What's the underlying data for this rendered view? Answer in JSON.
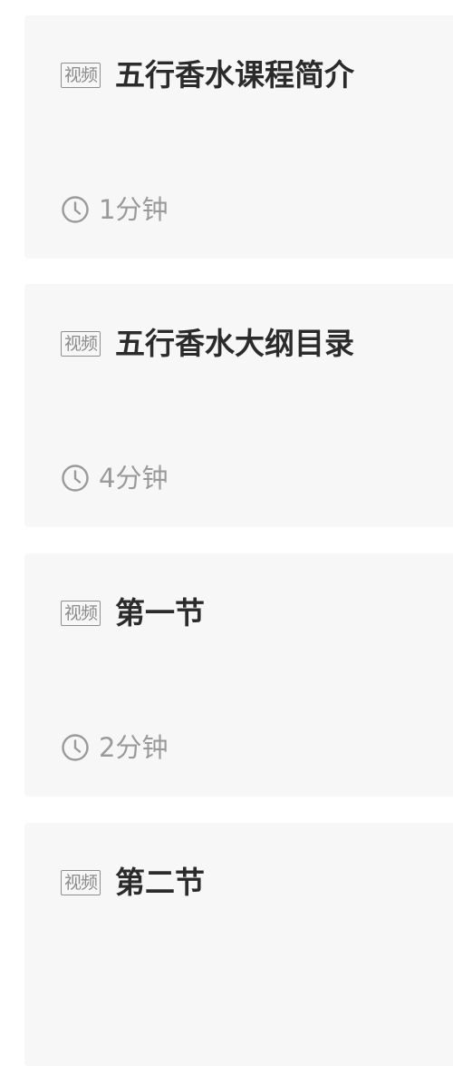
{
  "lessons": [
    {
      "badge": "视频",
      "title": "五行香水课程简介",
      "duration": "1分钟"
    },
    {
      "badge": "视频",
      "title": "五行香水大纲目录",
      "duration": "4分钟"
    },
    {
      "badge": "视频",
      "title": "第一节",
      "duration": "2分钟"
    },
    {
      "badge": "视频",
      "title": "第二节",
      "duration": ""
    }
  ],
  "icons": {
    "duration": "clock-icon"
  },
  "colors": {
    "card_background": "#f7f7f7",
    "title": "#2b2b2b",
    "badge": "#8a8a8a",
    "duration": "#9a9a9a"
  }
}
